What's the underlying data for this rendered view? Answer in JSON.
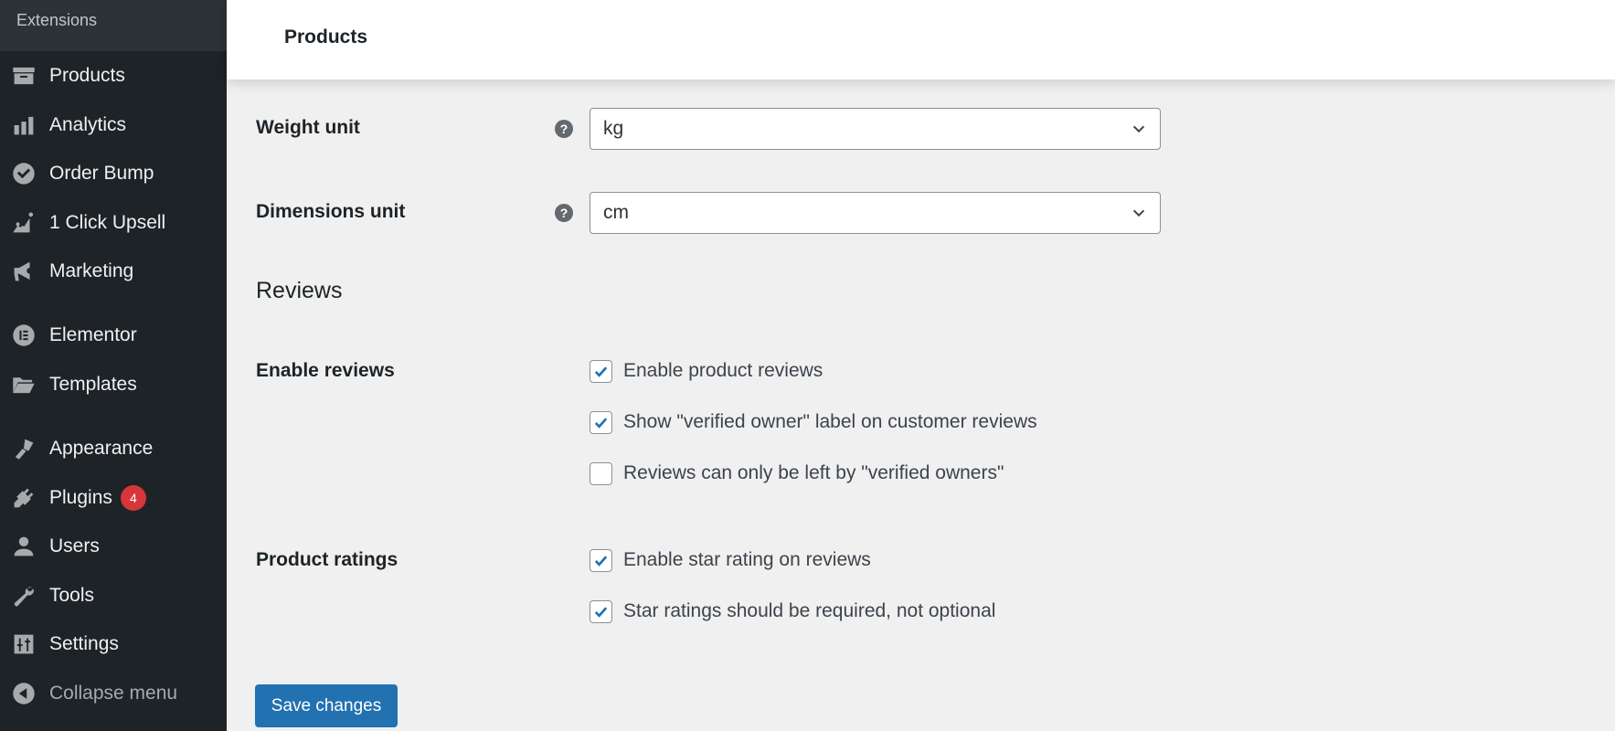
{
  "sidebar": {
    "section_header": "Extensions",
    "items": [
      {
        "label": "Products",
        "icon": "archive-box-icon"
      },
      {
        "label": "Analytics",
        "icon": "bar-chart-icon"
      },
      {
        "label": "Order Bump",
        "icon": "check-circle-icon"
      },
      {
        "label": "1 Click Upsell",
        "icon": "trend-chart-icon"
      },
      {
        "label": "Marketing",
        "icon": "megaphone-icon"
      },
      {
        "label": "Elementor",
        "icon": "elementor-icon"
      },
      {
        "label": "Templates",
        "icon": "folder-open-icon"
      },
      {
        "label": "Appearance",
        "icon": "paintbrush-icon"
      },
      {
        "label": "Plugins",
        "icon": "plug-icon",
        "badge": "4"
      },
      {
        "label": "Users",
        "icon": "user-icon"
      },
      {
        "label": "Tools",
        "icon": "wrench-icon"
      },
      {
        "label": "Settings",
        "icon": "sliders-icon"
      },
      {
        "label": "Collapse menu",
        "icon": "collapse-arrow-icon"
      }
    ]
  },
  "header": {
    "title": "Products"
  },
  "form": {
    "weight_unit": {
      "label": "Weight unit",
      "value": "kg",
      "help": "?"
    },
    "dimensions_unit": {
      "label": "Dimensions unit",
      "value": "cm",
      "help": "?"
    },
    "reviews_section_title": "Reviews",
    "enable_reviews": {
      "label": "Enable reviews",
      "options": [
        {
          "label": "Enable product reviews",
          "checked": true
        },
        {
          "label": "Show \"verified owner\" label on customer reviews",
          "checked": true
        },
        {
          "label": "Reviews can only be left by \"verified owners\"",
          "checked": false
        }
      ]
    },
    "product_ratings": {
      "label": "Product ratings",
      "options": [
        {
          "label": "Enable star rating on reviews",
          "checked": true
        },
        {
          "label": "Star ratings should be required, not optional",
          "checked": true
        }
      ]
    },
    "save_label": "Save changes"
  },
  "colors": {
    "sidebar_bg": "#1d2327",
    "accent": "#2271b1",
    "badge": "#d63638"
  }
}
